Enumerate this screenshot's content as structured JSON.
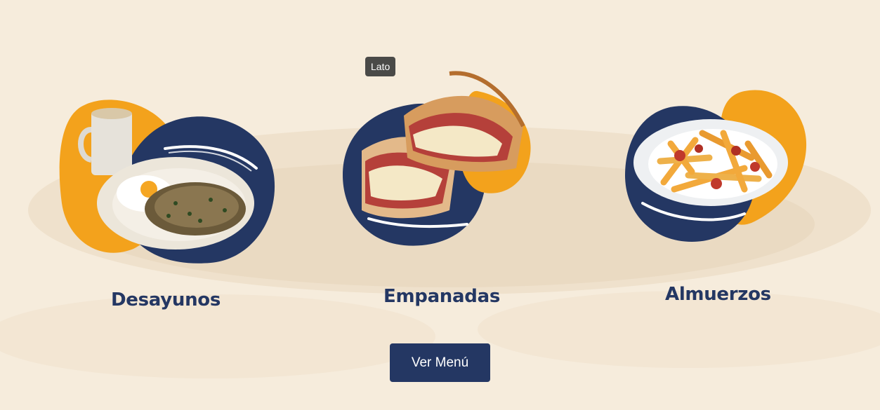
{
  "colors": {
    "background": "#f6ecdc",
    "navy": "#243763",
    "orange": "#f3a21c",
    "tooltip": "#4a4a48"
  },
  "categories": [
    {
      "title": "Desayunos",
      "image": "breakfast-plate-icon"
    },
    {
      "title": "Empanadas",
      "image": "empanadas-icon"
    },
    {
      "title": "Almuerzos",
      "image": "fries-plate-icon"
    }
  ],
  "tooltip": {
    "text": "Lato"
  },
  "cta": {
    "label": "Ver Menú"
  }
}
